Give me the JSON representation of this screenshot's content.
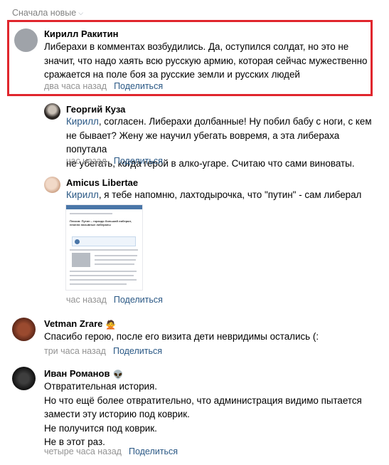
{
  "sort": {
    "label": "Сначала новые"
  },
  "comments": [
    {
      "author": "Кирилл Ракитин",
      "lines": [
        "Либерахи в комментах возбудились. Да, оступился солдат, но это не",
        "значит, что надо хаять всю русскую армию, которая сейчас мужественно",
        "сражается на поле боя за русские земли и русских людей"
      ],
      "time": "два часа назад",
      "share": "Поделиться"
    },
    {
      "author": "Георгий Куза",
      "mention": "Кирилл",
      "lines": [
        ", согласен. Либерахи долбанные! Ну побил бабу с ноги, с кем",
        "не бывает? Жену же научил убегать вовремя, а эта либераха попутала",
        "не убегать, когда герой в алко-угаре. Считаю что сами виноваты."
      ],
      "time": "час назад",
      "share": "Поделиться"
    },
    {
      "author": "Amicus Libertae",
      "mention": "Кирилл",
      "lines": [
        ", я тебе напомню, лахтодырочка, что \"путин\" - сам либерал"
      ],
      "attachment_title": "Песков: Путин – гораздо больший либерал, нежели назывные либералы",
      "time": "час назад",
      "share": "Поделиться"
    },
    {
      "author": "Vetman Zrare",
      "author_emoji": "🙅",
      "lines": [
        "Спасибо герою, после его визита дети невридимы остались (:"
      ],
      "time": "три часа назад",
      "share": "Поделиться"
    },
    {
      "author": "Иван Романов",
      "author_emoji": "👽",
      "lines": [
        "Отвратительная история.",
        "Но что ещё более отвратительно, что администрация видимо пытается",
        "замести эту историю под коврик.",
        "Не получится под коврик.",
        "Не в этот раз."
      ],
      "time": "четыре часа назад",
      "share": "Поделиться"
    }
  ],
  "colors": {
    "link": "#2a5885",
    "meta": "#939393",
    "highlight": "#e0262d"
  }
}
